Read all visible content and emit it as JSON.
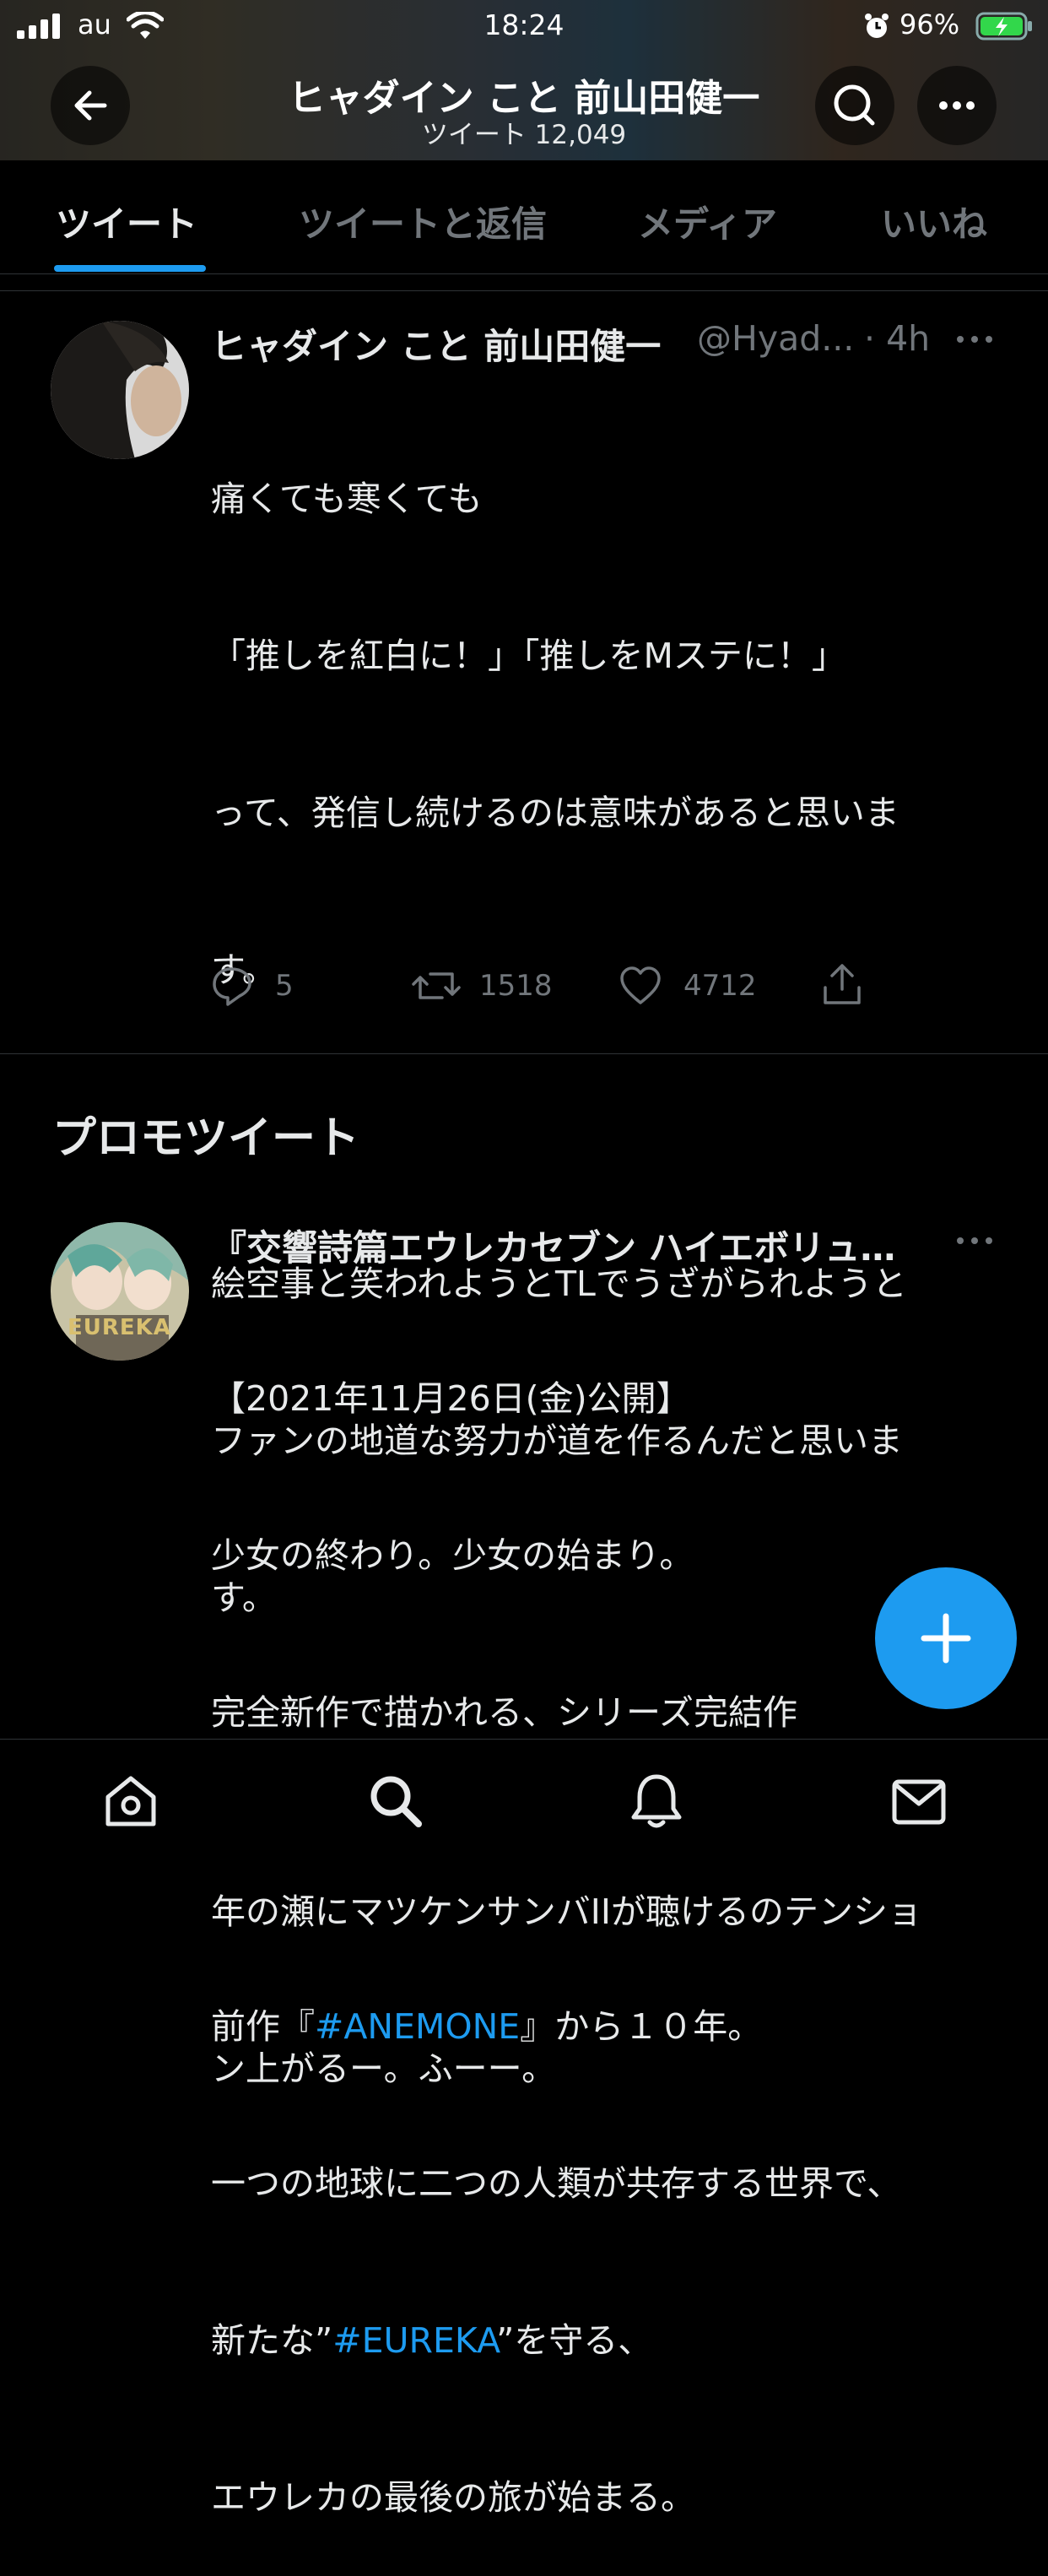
{
  "status_bar": {
    "carrier": "au",
    "time": "18:24",
    "battery": "96%"
  },
  "header": {
    "title": "ヒャダイン こと 前山田健一",
    "subtitle": "ツイート 12,049"
  },
  "tabs": [
    {
      "label": "ツイート",
      "active": true
    },
    {
      "label": "ツイートと返信",
      "active": false
    },
    {
      "label": "メディア",
      "active": false
    },
    {
      "label": "いいね",
      "active": false
    }
  ],
  "tweet1": {
    "name": "ヒャダイン こと 前山田健一",
    "handle": "@Hyad...",
    "time": "· 4h",
    "lines": [
      "痛くても寒くても",
      "「推しを紅白に！」「推しをMステに！」",
      "って、発信し続けるのは意味があると思いま",
      "す。",
      "",
      "絵空事と笑われようとTLでうざがられようと",
      "ファンの地道な努力が道を作るんだと思いま",
      "す。",
      "",
      "年の瀬にマツケンサンバIIが聴けるのテンショ",
      "ン上がるー。ふーー。"
    ],
    "replies": "5",
    "retweets": "1518",
    "likes": "4712"
  },
  "promo_section_title": "プロモツイート",
  "tweet2": {
    "name": "『交響詩篇エウレカセブン ハイエボリュ…",
    "avatar_text": "EUREKA",
    "line1": "【2021年11月26日(金)公開】",
    "line2": "少女の終わり。少女の始まり。",
    "line3": "完全新作で描かれる、シリーズ完結作",
    "line5_pre": "前作『",
    "line5_hash": "#ANEMONE",
    "line5_post": "』から１０年。",
    "line6": "一つの地球に二つの人類が共存する世界で、",
    "line7_pre": "新たな”",
    "line7_hash": "#EUREKA",
    "line7_post": "”を守る、",
    "line8": "エウレカの最後の旅が始まる。"
  },
  "icons": {
    "back": "arrow-left-icon",
    "search": "search-icon",
    "more": "more-icon",
    "reply": "reply-icon",
    "retweet": "retweet-icon",
    "like": "heart-icon",
    "share": "share-icon",
    "compose": "plus-icon",
    "home": "home-icon",
    "explore": "search-icon",
    "notifications": "bell-icon",
    "messages": "mail-icon"
  },
  "colors": {
    "accent": "#1d9bf0",
    "background": "#000000",
    "text": "#e7e9ea",
    "muted": "#71767b"
  }
}
